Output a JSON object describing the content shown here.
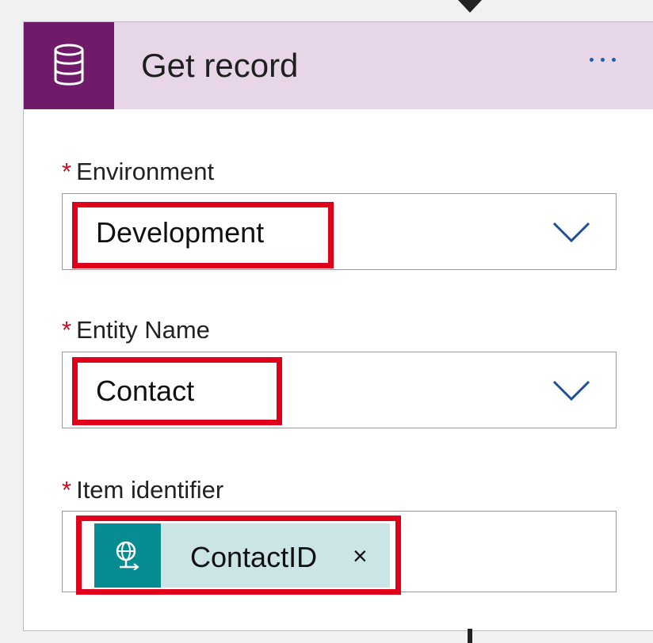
{
  "action_card": {
    "title": "Get record",
    "header_icon": "database-icon",
    "more_icon": "ellipsis-icon",
    "colors": {
      "header_background": "#e6d6e7",
      "icon_background": "#6f1b69",
      "highlight": "#e0001b",
      "token_background": "#cbe4e6",
      "token_icon_background": "#068c91"
    }
  },
  "form": {
    "environment": {
      "required_marker": "*",
      "label": "Environment",
      "value": "Development",
      "dropdown_icon": "chevron-down-icon"
    },
    "entity_name": {
      "required_marker": "*",
      "label": "Entity Name",
      "value": "Contact",
      "dropdown_icon": "chevron-down-icon"
    },
    "item_identifier": {
      "required_marker": "*",
      "label": "Item identifier",
      "token_label": "ContactID",
      "token_icon": "globe-request-icon",
      "remove_label": "×"
    }
  }
}
